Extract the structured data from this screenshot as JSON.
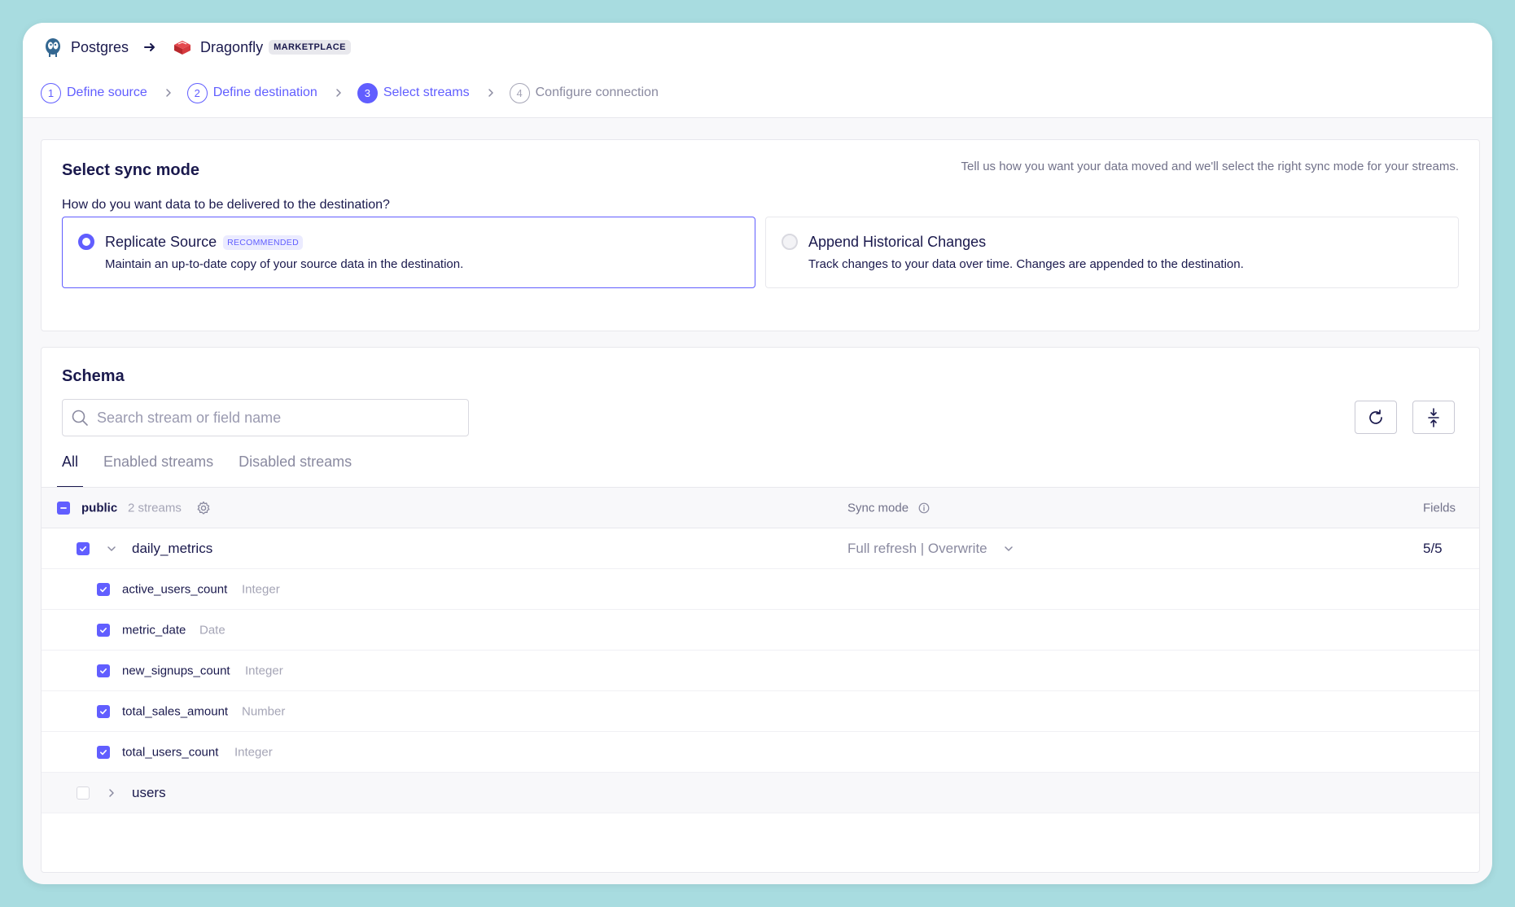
{
  "connection": {
    "source_name": "Postgres",
    "destination_name": "Dragonfly",
    "destination_badge": "MARKETPLACE"
  },
  "steps": [
    {
      "num": "1",
      "label": "Define source"
    },
    {
      "num": "2",
      "label": "Define destination"
    },
    {
      "num": "3",
      "label": "Select streams"
    },
    {
      "num": "4",
      "label": "Configure connection"
    }
  ],
  "sync_mode": {
    "title": "Select sync mode",
    "hint": "Tell us how you want your data moved and we'll select the right sync mode for your streams.",
    "question": "How do you want data to be delivered to the destination?",
    "options": [
      {
        "title": "Replicate Source",
        "badge": "RECOMMENDED",
        "desc": "Maintain an up-to-date copy of your source data in the destination.",
        "selected": true
      },
      {
        "title": "Append Historical Changes",
        "desc": "Track changes to your data over time. Changes are appended to the destination.",
        "selected": false
      }
    ]
  },
  "schema": {
    "title": "Schema",
    "search_placeholder": "Search stream or field name",
    "tabs": [
      "All",
      "Enabled streams",
      "Disabled streams"
    ],
    "namespace": {
      "name": "public",
      "count": "2 streams"
    },
    "headers": {
      "sync_mode": "Sync mode",
      "fields": "Fields"
    },
    "streams": [
      {
        "name": "daily_metrics",
        "enabled": true,
        "expanded": true,
        "sync_mode": "Full refresh | Overwrite",
        "fields_count": "5/5",
        "fields": [
          {
            "name": "active_users_count",
            "type": "Integer"
          },
          {
            "name": "metric_date",
            "type": "Date"
          },
          {
            "name": "new_signups_count",
            "type": "Integer"
          },
          {
            "name": "total_sales_amount",
            "type": "Number"
          },
          {
            "name": "total_users_count",
            "type": "Integer"
          }
        ]
      },
      {
        "name": "users",
        "enabled": false,
        "expanded": false
      }
    ]
  },
  "colors": {
    "accent": "#615eff",
    "text": "#1a194d",
    "muted": "#8a8aa0",
    "background": "#a8dce0"
  }
}
